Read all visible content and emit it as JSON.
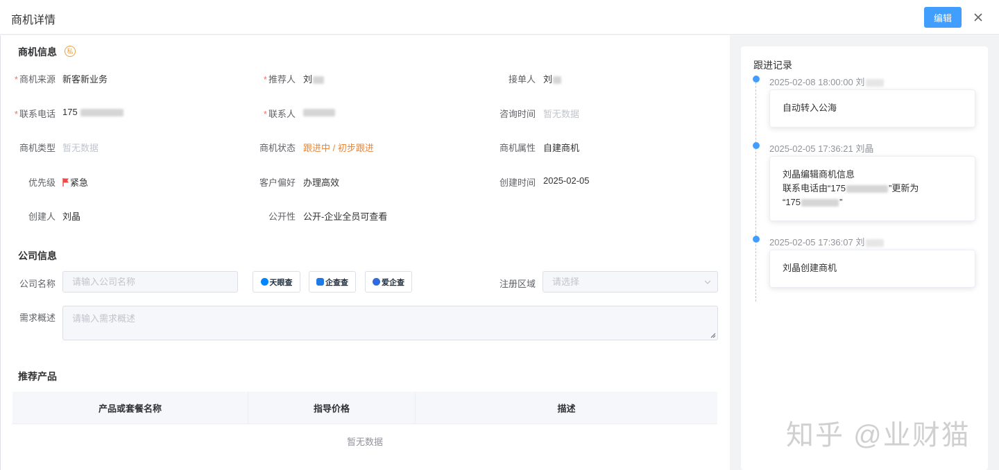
{
  "header": {
    "title": "商机详情",
    "edit_label": "编辑"
  },
  "biz_info": {
    "section_title": "商机信息",
    "private_badge": "私",
    "fields": {
      "source": {
        "label": "商机来源",
        "value": "新客新业务",
        "required": "*"
      },
      "referrer": {
        "label": "推荐人",
        "value": "刘",
        "required": "*"
      },
      "receiver": {
        "label": "接单人",
        "value": "刘"
      },
      "phone": {
        "label": "联系电话",
        "value": "175",
        "required": "*"
      },
      "contact": {
        "label": "联系人",
        "value": "",
        "required": "*"
      },
      "consult_time": {
        "label": "咨询时间",
        "value": "暂无数据"
      },
      "biz_type": {
        "label": "商机类型",
        "value": "暂无数据"
      },
      "biz_status": {
        "label": "商机状态",
        "value": "跟进中 / 初步跟进"
      },
      "biz_attr": {
        "label": "商机属性",
        "value": "自建商机"
      },
      "priority": {
        "label": "优先级",
        "value": "紧急"
      },
      "preference": {
        "label": "客户偏好",
        "value": "办理高效"
      },
      "created_time": {
        "label": "创建时间",
        "value": "2025-02-05"
      },
      "creator": {
        "label": "创建人",
        "value": "刘晶"
      },
      "visibility": {
        "label": "公开性",
        "value": "公开-企业全员可查看"
      }
    }
  },
  "company_info": {
    "section_title": "公司信息",
    "company_name_label": "公司名称",
    "company_name_placeholder": "请输入公司名称",
    "lookup_buttons": [
      "天眼查",
      "企查查",
      "爱企查"
    ],
    "region_label": "注册区域",
    "region_placeholder": "请选择",
    "demand_label": "需求概述",
    "demand_placeholder": "请输入需求概述"
  },
  "products": {
    "section_title": "推荐产品",
    "columns": [
      "产品或套餐名称",
      "指导价格",
      "描述"
    ],
    "empty_text": "暂无数据"
  },
  "followup": {
    "title": "跟进记录",
    "items": [
      {
        "time": "2025-02-08 18:00:00 刘",
        "lines": [
          "自动转入公海"
        ]
      },
      {
        "time": "2025-02-05 17:36:21 刘晶",
        "lines": [
          "刘晶编辑商机信息",
          "联系电话由“175",
          "”更新为",
          "“175",
          "”"
        ]
      },
      {
        "time": "2025-02-05 17:36:07 刘",
        "lines": [
          "刘晶创建商机"
        ]
      }
    ]
  },
  "watermark": "知乎 @业财猫",
  "colors": {
    "primary": "#409eff",
    "required": "#f56c6c",
    "status": "#e6873c",
    "flag": "#f04848",
    "badge": "#e6a23c"
  }
}
